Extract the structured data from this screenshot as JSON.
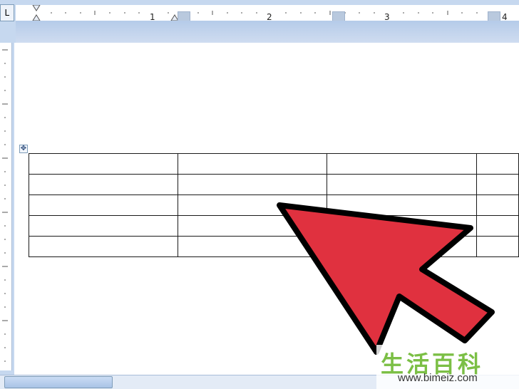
{
  "ruler": {
    "tab_selector": "L",
    "numbers": [
      "1",
      "2",
      "3",
      "4"
    ]
  },
  "table": {
    "rows": 5,
    "cols": 4
  },
  "arrow": {
    "color": "#e0313f",
    "outline": "#000000"
  },
  "watermark": {
    "logo": "生活百科",
    "url": "www.bimeiz.com"
  },
  "colors": {
    "ruler_background": "#c6d8ef",
    "accent": "#7f9db9"
  }
}
